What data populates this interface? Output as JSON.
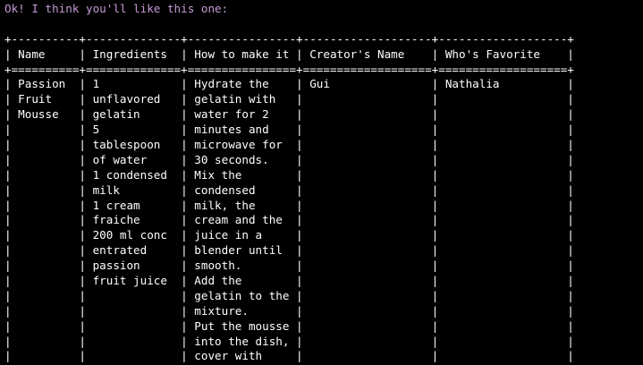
{
  "terminal": {
    "intro_message": "Ok! I think you'll like this one:",
    "colors": {
      "background": "#000000",
      "intro_text": "#c59ad6",
      "table_text": "#ffffff"
    },
    "table": {
      "border_line": "+----------+--------------+----------------+-------------------+-------------------+",
      "header_row": "| Name     | Ingredients  | How to make it | Creator's Name    | Who's Favorite    |",
      "header_separator": "+==========+==============+================+===================+===================+",
      "body_rows": [
        "| Passion  | 1            | Hydrate the    | Gui               | Nathalia          |",
        "| Fruit    | unflavored   | gelatin with   |                   |                   |",
        "| Mousse   | gelatin      | water for 2    |                   |                   |",
        "|          | 5            | minutes and    |                   |                   |",
        "|          | tablespoon   | microwave for  |                   |                   |",
        "|          | of water     | 30 seconds.    |                   |                   |",
        "|          | 1 condensed  | Mix the        |                   |                   |",
        "|          | milk         | condensed      |                   |                   |",
        "|          | 1 cream      | milk, the      |                   |                   |",
        "|          | fraiche      | cream and the  |                   |                   |",
        "|          | 200 ml conc  | juice in a     |                   |                   |",
        "|          | entrated     | blender until  |                   |                   |",
        "|          | passion      | smooth.        |                   |                   |",
        "|          | fruit juice  | Add the        |                   |                   |",
        "|          |              | gelatin to the |                   |                   |",
        "|          |              | mixture.       |                   |                   |",
        "|          |              | Put the mousse |                   |                   |",
        "|          |              | into the dish, |                   |                   |",
        "|          |              | cover with     |                   |                   |"
      ]
    }
  }
}
